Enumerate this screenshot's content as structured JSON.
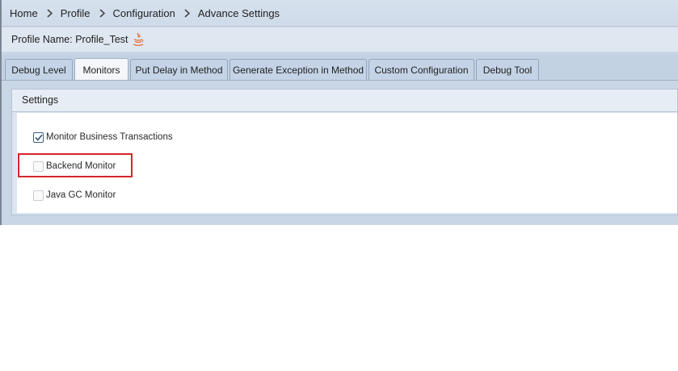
{
  "breadcrumb": [
    "Home",
    "Profile",
    "Configuration",
    "Advance Settings"
  ],
  "profile": {
    "label": "Profile Name: Profile_Test",
    "icon": "java-icon"
  },
  "tabs": [
    {
      "label": "Debug Level",
      "active": false
    },
    {
      "label": "Monitors",
      "active": true
    },
    {
      "label": "Put Delay in Method",
      "active": false
    },
    {
      "label": "Generate Exception in Method",
      "active": false
    },
    {
      "label": "Custom Configuration",
      "active": false
    },
    {
      "label": "Debug Tool",
      "active": false
    }
  ],
  "settings": {
    "title": "Settings",
    "options": [
      {
        "label": "Monitor Business Transactions",
        "checked": true,
        "highlighted": false
      },
      {
        "label": "Backend Monitor",
        "checked": false,
        "highlighted": true
      },
      {
        "label": "Java GC Monitor",
        "checked": false,
        "highlighted": false
      }
    ]
  },
  "colors": {
    "highlight": "#d6262b",
    "accent": "#3b5d8a"
  }
}
